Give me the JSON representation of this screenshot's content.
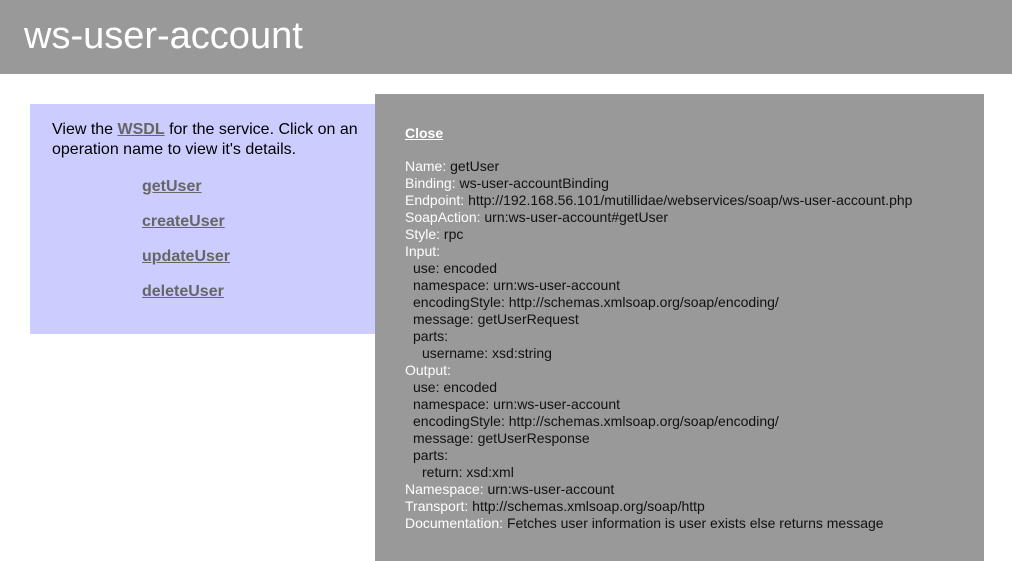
{
  "header": {
    "title": "ws-user-account"
  },
  "panel": {
    "intro_prefix": "View the ",
    "wsdl_link": "WSDL",
    "intro_suffix": " for the service. Click on an operation name to view it's details.",
    "operations": [
      "getUser",
      "createUser",
      "updateUser",
      "deleteUser"
    ]
  },
  "popup": {
    "close_label": "Close",
    "name_label": "Name:",
    "name_value": "getUser",
    "binding_label": "Binding:",
    "binding_value": "ws-user-accountBinding",
    "endpoint_label": "Endpoint:",
    "endpoint_value": "http://192.168.56.101/mutillidae/webservices/soap/ws-user-account.php",
    "soapaction_label": "SoapAction:",
    "soapaction_value": "urn:ws-user-account#getUser",
    "style_label": "Style:",
    "style_value": "rpc",
    "input_label": "Input:",
    "input": {
      "use_label": "use:",
      "use_value": "encoded",
      "namespace_label": "namespace:",
      "namespace_value": "urn:ws-user-account",
      "encoding_label": "encodingStyle:",
      "encoding_value": "http://schemas.xmlsoap.org/soap/encoding/",
      "message_label": "message:",
      "message_value": "getUserRequest",
      "parts_label": "parts:",
      "part_label": "username:",
      "part_value": "xsd:string"
    },
    "output_label": "Output:",
    "output": {
      "use_label": "use:",
      "use_value": "encoded",
      "namespace_label": "namespace:",
      "namespace_value": "urn:ws-user-account",
      "encoding_label": "encodingStyle:",
      "encoding_value": "http://schemas.xmlsoap.org/soap/encoding/",
      "message_label": "message:",
      "message_value": "getUserResponse",
      "parts_label": "parts:",
      "part_label": "return:",
      "part_value": "xsd:xml"
    },
    "namespace_label": "Namespace:",
    "namespace_value": "urn:ws-user-account",
    "transport_label": "Transport:",
    "transport_value": "http://schemas.xmlsoap.org/soap/http",
    "documentation_label": "Documentation:",
    "documentation_value": "Fetches user information is user exists else returns message"
  },
  "colors": {
    "header_bg": "#999999",
    "panel_bg": "#ccccff",
    "popup_bg": "#999999",
    "link": "#666666"
  }
}
